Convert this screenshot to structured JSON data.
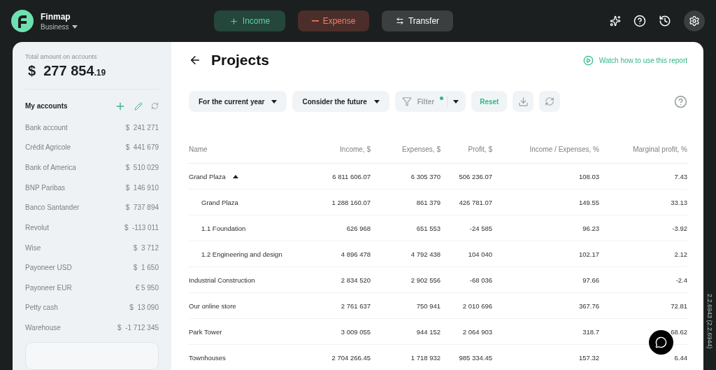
{
  "app": {
    "name": "Finmap",
    "workspace": "Business"
  },
  "actions": [
    {
      "label": "Income",
      "kind": "income"
    },
    {
      "label": "Expense",
      "kind": "expense"
    },
    {
      "label": "Transfer",
      "kind": "transfer"
    }
  ],
  "sidebar": {
    "total_label": "Total amount on accounts",
    "total_main": "$  277 854",
    "total_cents": ".19",
    "accounts_title": "My accounts",
    "accounts": [
      {
        "name": "Bank account",
        "amount": "$  241 271"
      },
      {
        "name": "Crédit Agricole",
        "amount": "$  441 679"
      },
      {
        "name": "Bank of America",
        "amount": "$  510 029"
      },
      {
        "name": "BNP Paribas",
        "amount": "$  146 910"
      },
      {
        "name": "Banco Santander",
        "amount": "$  737 894"
      },
      {
        "name": "Revolut",
        "amount": "$  -113 011"
      },
      {
        "name": "Wise",
        "amount": "$  3 712"
      },
      {
        "name": "Payoneer USD",
        "amount": "$  1 650"
      },
      {
        "name": "Payoneer EUR",
        "amount": "€ 5 950"
      },
      {
        "name": "Petty cash",
        "amount": "$  13 090"
      },
      {
        "name": "Warehouse",
        "amount": "$  -1 712 345"
      }
    ]
  },
  "report": {
    "title": "Projects",
    "video_link": "Watch how to use this report",
    "filters": [
      "For the current year",
      "Consider the future"
    ],
    "filter": {
      "label": "Filter",
      "active": true
    },
    "reset": "Reset",
    "columns": [
      "Name",
      "Income,  $",
      "Expenses,  $",
      "Profit,  $",
      "Income / Expenses, %",
      "Marginal profit, %"
    ],
    "rows": [
      {
        "cells": [
          "Grand Plaza",
          "6 811 606.07",
          "6 305 370",
          "506 236.07",
          "108.03",
          "7.43"
        ],
        "expanded": true,
        "children": [
          {
            "cells": [
              "Grand Plaza",
              "1 288 160.07",
              "861 379",
              "426 781.07",
              "149.55",
              "33.13"
            ]
          },
          {
            "cells": [
              "1.1 Foundation",
              "626 968",
              "651 553",
              "-24 585",
              "96.23",
              "-3.92"
            ]
          },
          {
            "cells": [
              "1.2 Engineering and design",
              "4 896 478",
              "4 792 438",
              "104 040",
              "102.17",
              "2.12"
            ]
          }
        ]
      },
      {
        "cells": [
          "Industrial Construction",
          "2 834 520",
          "2 902 556",
          "-68 036",
          "97.66",
          "-2.4"
        ]
      },
      {
        "cells": [
          "Our online store",
          "2 761 637",
          "750 941",
          "2 010 696",
          "367.76",
          "72.81"
        ]
      },
      {
        "cells": [
          "Park Tower",
          "3 009 055",
          "944 152",
          "2 064 903",
          "318.7",
          "68.62"
        ]
      },
      {
        "cells": [
          "Townhouses",
          "2 704 266.45",
          "1 718 932",
          "985 334.45",
          "157.32",
          "6.44"
        ]
      }
    ]
  },
  "version": "2.2.6943 (2.2.6944)"
}
